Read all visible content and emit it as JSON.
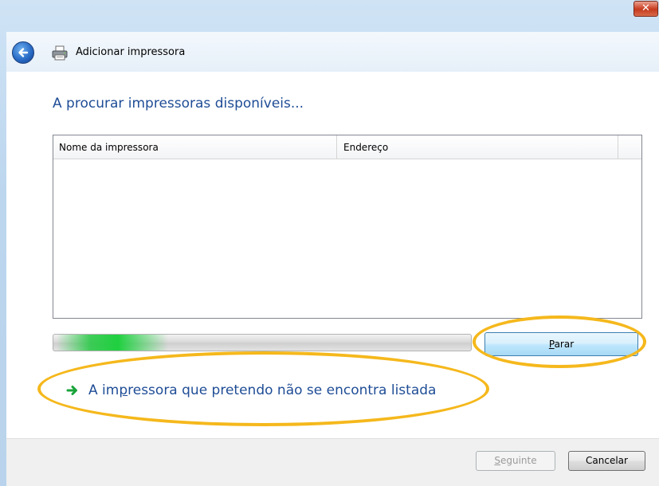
{
  "window": {
    "title": "Adicionar impressora",
    "close_glyph": "✕"
  },
  "icons": {
    "back": "back-arrow-icon",
    "printer": "printer-icon",
    "link_arrow": "green-arrow-icon",
    "close": "close-icon"
  },
  "colors": {
    "heading": "#1f4d96",
    "highlight": "#f5b81c",
    "progress": "#1fd03f"
  },
  "main": {
    "heading": "A procurar impressoras disponíveis...",
    "columns": [
      "Nome da impressora",
      "Endereço"
    ],
    "rows": []
  },
  "progress": {
    "state": "indeterminate"
  },
  "stop_button": {
    "label_accel": "P",
    "label_rest": "arar"
  },
  "not_listed_link": {
    "text_before": "A im",
    "text_accel": "p",
    "text_after": "ressora que pretendo não se encontra listada"
  },
  "footer": {
    "next_accel": "S",
    "next_rest": "eguinte",
    "cancel_label": "Cancelar"
  }
}
